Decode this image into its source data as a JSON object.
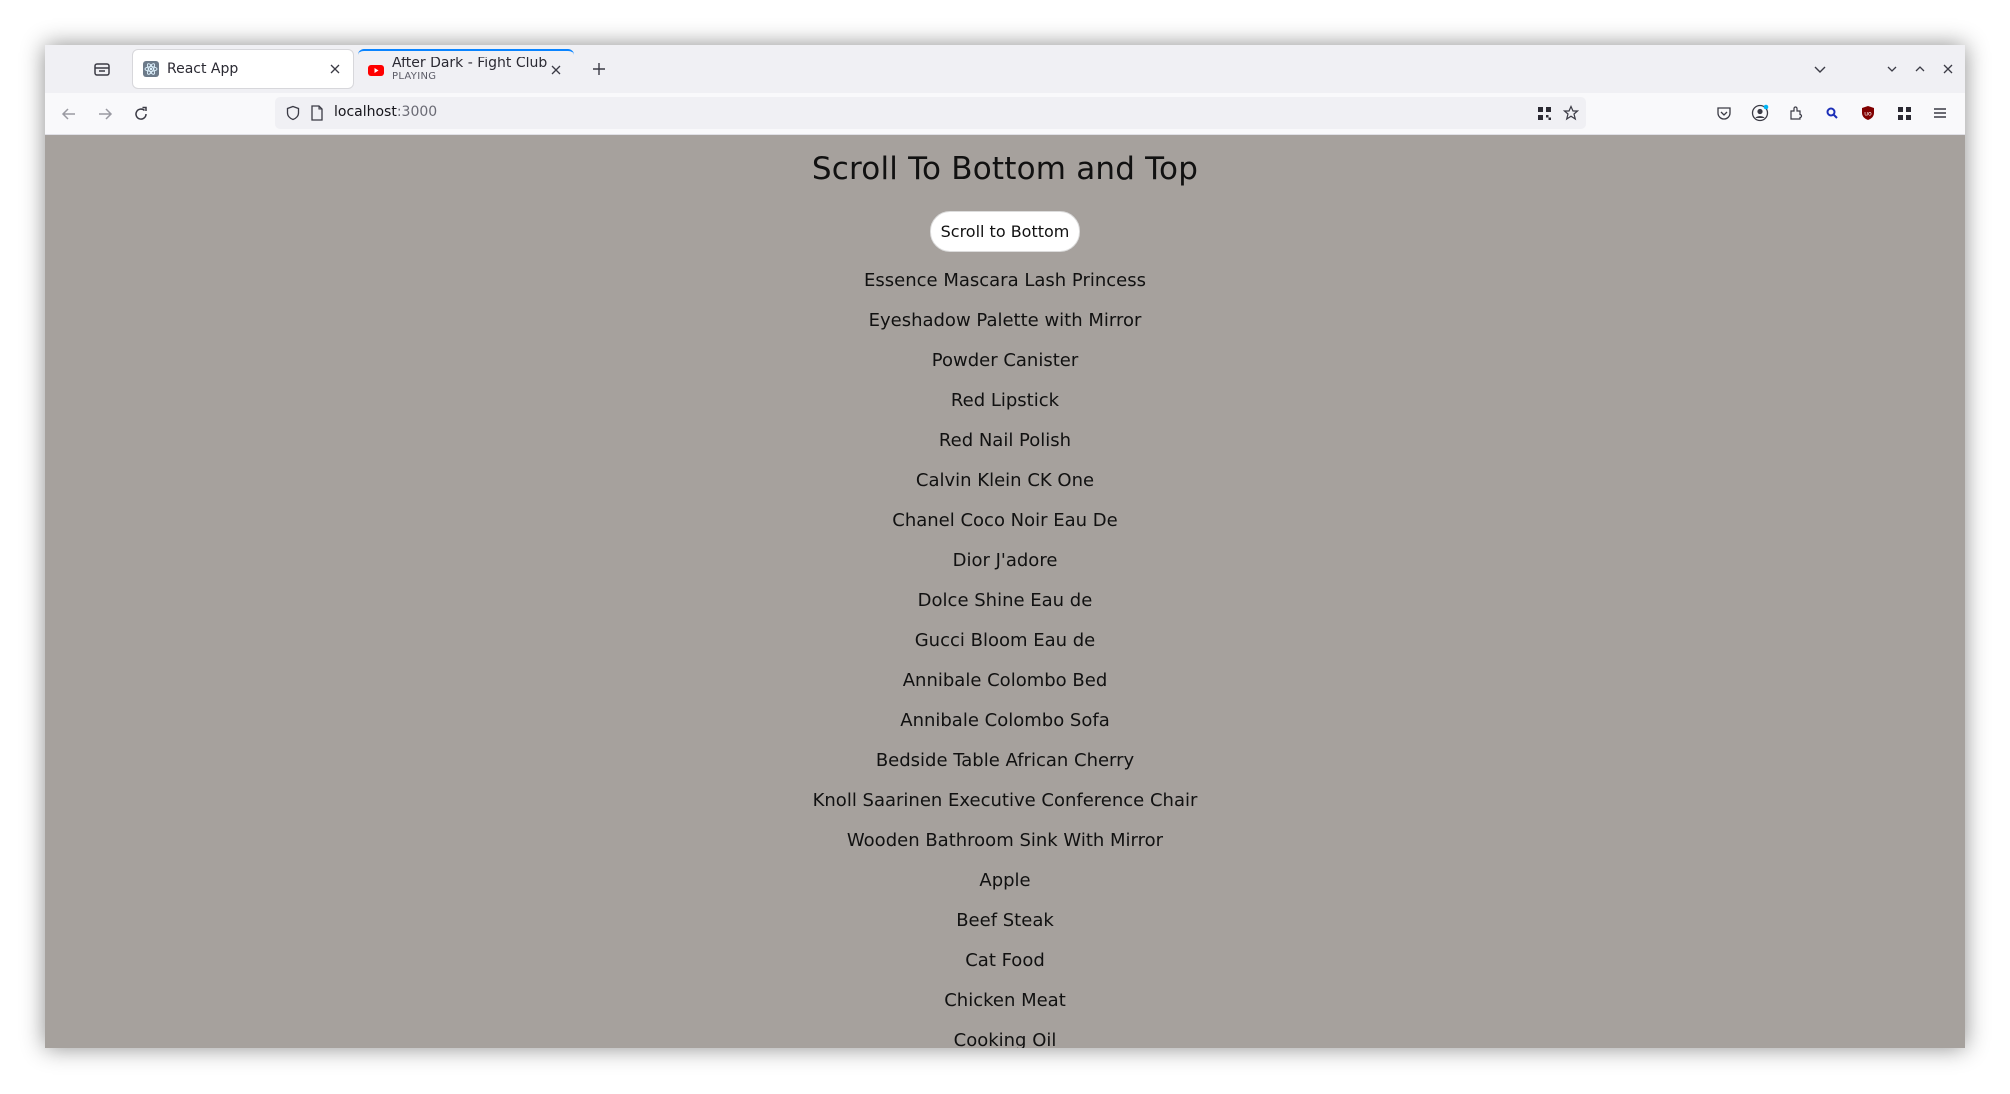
{
  "browser": {
    "tabs": [
      {
        "title": "React App",
        "subtitle": ""
      },
      {
        "title": "After Dark - Fight Club | RE",
        "subtitle": "PLAYING"
      }
    ],
    "url": {
      "host": "localhost",
      "port": ":3000"
    }
  },
  "page": {
    "title": "Scroll To Bottom and Top",
    "button_label": "Scroll to Bottom",
    "products": [
      "Essence Mascara Lash Princess",
      "Eyeshadow Palette with Mirror",
      "Powder Canister",
      "Red Lipstick",
      "Red Nail Polish",
      "Calvin Klein CK One",
      "Chanel Coco Noir Eau De",
      "Dior J'adore",
      "Dolce Shine Eau de",
      "Gucci Bloom Eau de",
      "Annibale Colombo Bed",
      "Annibale Colombo Sofa",
      "Bedside Table African Cherry",
      "Knoll Saarinen Executive Conference Chair",
      "Wooden Bathroom Sink With Mirror",
      "Apple",
      "Beef Steak",
      "Cat Food",
      "Chicken Meat",
      "Cooking Oil"
    ]
  },
  "colors": {
    "page_background": "#a6a19d",
    "tab_accent": "#0a84ff",
    "youtube_red": "#ff0000"
  }
}
